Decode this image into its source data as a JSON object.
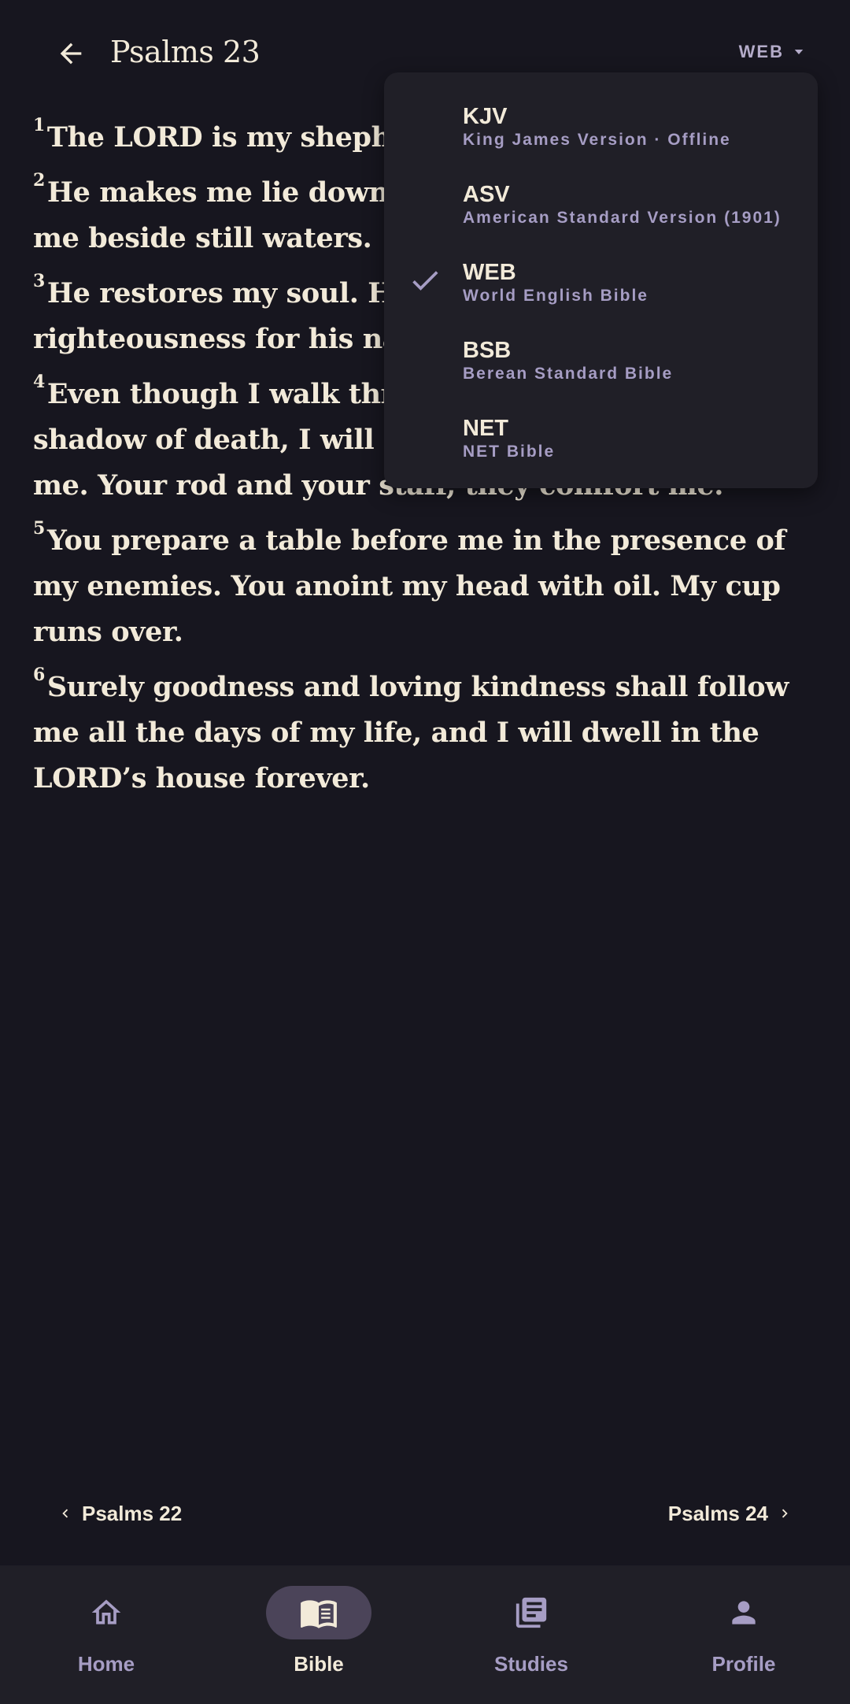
{
  "header": {
    "title": "Psalms 23",
    "version_label": "WEB"
  },
  "verses": [
    {
      "number": "1",
      "text": "The LORD is my shepherd; I shall lack nothing."
    },
    {
      "number": "2",
      "text": "He makes me lie down in green pastures. He leads me beside still waters."
    },
    {
      "number": "3",
      "text": "He restores my soul. He guides me in the paths of righteousness for his name’s sake."
    },
    {
      "number": "4",
      "text": "Even though I walk through the valley of the shadow of death, I will fear no evil, for you are with me. Your rod and your staff, they comfort me."
    },
    {
      "number": "5",
      "text": "You prepare a table before me in the presence of my enemies. You anoint my head with oil. My cup runs over."
    },
    {
      "number": "6",
      "text": "Surely goodness and loving kindness shall follow me all the days of my life, and I will dwell in the LORD’s house forever."
    }
  ],
  "version_menu": {
    "items": [
      {
        "abbr": "KJV",
        "name": "King James Version · Offline",
        "selected": false
      },
      {
        "abbr": "ASV",
        "name": "American Standard Version (1901)",
        "selected": false
      },
      {
        "abbr": "WEB",
        "name": "World English Bible",
        "selected": true
      },
      {
        "abbr": "BSB",
        "name": "Berean Standard Bible",
        "selected": false
      },
      {
        "abbr": "NET",
        "name": "NET Bible",
        "selected": false
      }
    ]
  },
  "chapter_nav": {
    "prev_label": "Psalms 22",
    "next_label": "Psalms 24"
  },
  "bottom_nav": {
    "items": [
      {
        "label": "Home",
        "icon": "home-icon",
        "active": false
      },
      {
        "label": "Bible",
        "icon": "book-icon",
        "active": true
      },
      {
        "label": "Studies",
        "icon": "library-icon",
        "active": false
      },
      {
        "label": "Profile",
        "icon": "person-icon",
        "active": false
      }
    ]
  },
  "colors": {
    "background": "#17161f",
    "surface": "#201f27",
    "text": "#f2ead9",
    "muted": "#a69dc4",
    "active_pill": "#4b4459"
  }
}
